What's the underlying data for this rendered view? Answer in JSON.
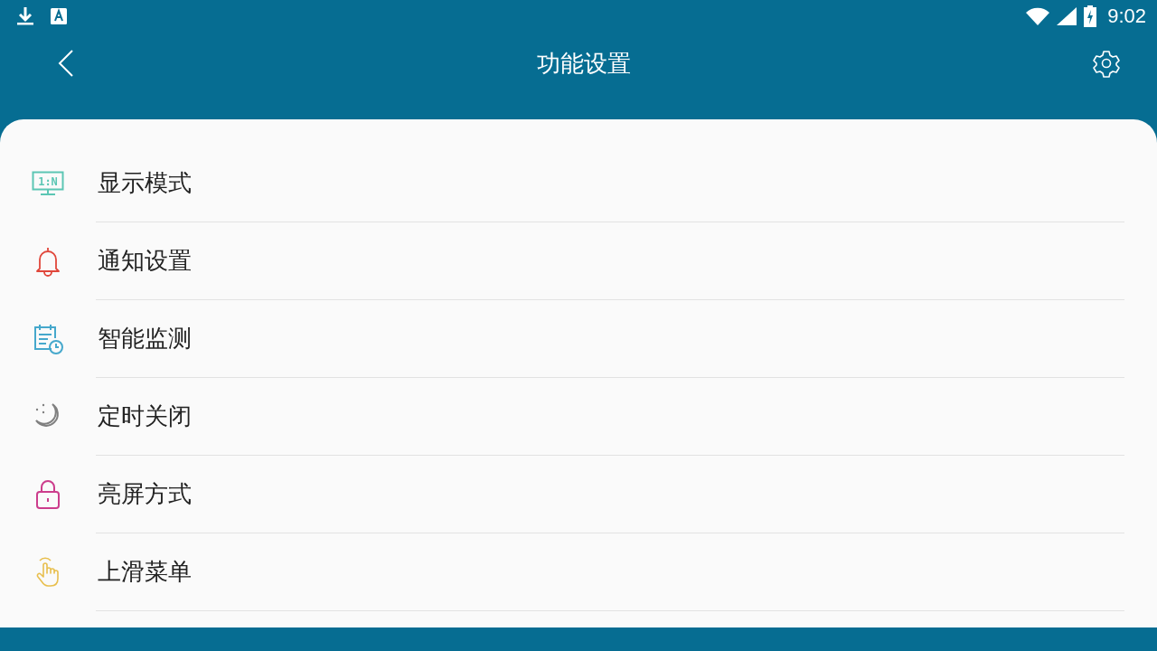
{
  "status_bar": {
    "time": "9:02"
  },
  "header": {
    "title": "功能设置"
  },
  "items": [
    {
      "kind": "monitor",
      "label": "显示模式",
      "icon_text": "1:N",
      "color": "#5cc6b4"
    },
    {
      "kind": "bell",
      "label": "通知设置",
      "color": "#e0463a"
    },
    {
      "kind": "calendar",
      "label": "智能监测",
      "color": "#46a8cc"
    },
    {
      "kind": "moon",
      "label": "定时关闭",
      "color": "#808080"
    },
    {
      "kind": "lock",
      "label": "亮屏方式",
      "color": "#cc3d8c"
    },
    {
      "kind": "hand",
      "label": "上滑菜单",
      "color": "#e8bf4e"
    }
  ]
}
